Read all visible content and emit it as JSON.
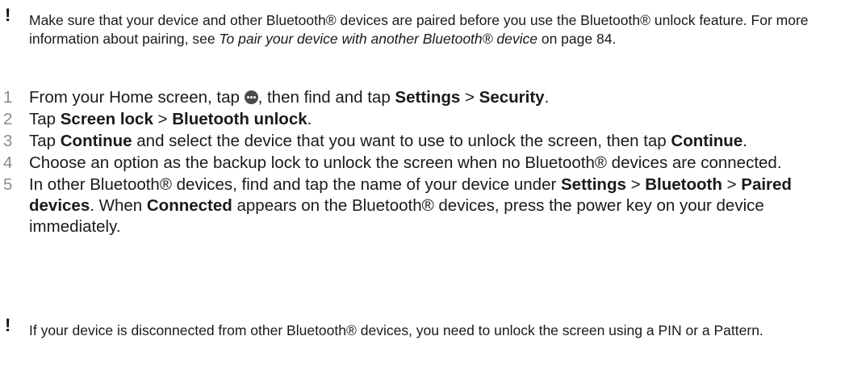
{
  "notes": {
    "first": {
      "mark": "!",
      "t1": "Make sure that your device and other Bluetooth® devices are paired before you use the Bluetooth® unlock feature. For more information about pairing, see ",
      "link": "To pair your device with another Bluetooth® device",
      "t2": " on page 84."
    },
    "second": {
      "mark": "!",
      "text": "If your device is disconnected from other Bluetooth® devices, you need to unlock the screen using a PIN or a Pattern."
    }
  },
  "steps": [
    {
      "num": "1",
      "a": "From your Home screen, tap ",
      "b": ", then find and tap ",
      "settings": "Settings",
      "sep": " > ",
      "security": "Security",
      "end": "."
    },
    {
      "num": "2",
      "a": "Tap ",
      "screen_lock": "Screen lock",
      "sep": " > ",
      "bt_unlock": "Bluetooth unlock",
      "end": "."
    },
    {
      "num": "3",
      "a": "Tap ",
      "cont1": "Continue",
      "b": " and select the device that you want to use to unlock the screen, then tap ",
      "cont2": "Continue",
      "end": "."
    },
    {
      "num": "4",
      "text": "Choose an option as the backup lock to unlock the screen when no Bluetooth® devices are connected."
    },
    {
      "num": "5",
      "a": "In other Bluetooth® devices, find and tap the name of your device under ",
      "settings": "Settings",
      "sep1": " > ",
      "bluetooth": "Bluetooth",
      "sep2": " > ",
      "paired": "Paired devices",
      "b": ". When ",
      "connected": "Connected",
      "c": " appears on the Bluetooth® devices, press the power key on your device immediately."
    }
  ],
  "icons": {
    "apps": "apps-grid-icon"
  }
}
